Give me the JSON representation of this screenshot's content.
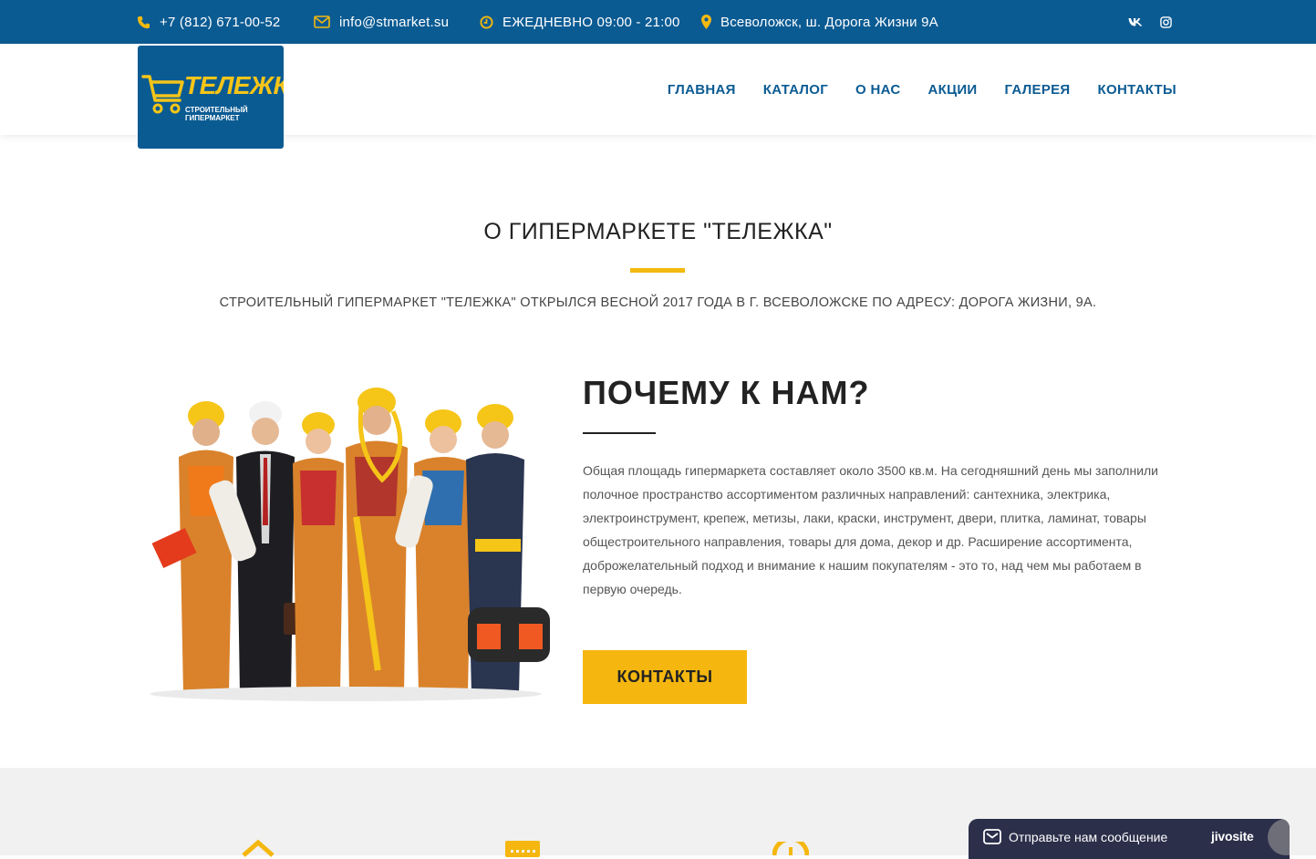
{
  "topbar": {
    "phone": "+7 (812) 671-00-52",
    "email": "info@stmarket.su",
    "hours": "ЕЖЕДНЕВНО 09:00 - 21:00",
    "address": "Всеволожск, ш. Дорога Жизни 9А",
    "social": [
      "vk-icon",
      "instagram-icon"
    ]
  },
  "header": {
    "logo_brand": "ТЕЛЕЖКА",
    "logo_tagline": "СТРОИТЕЛЬНЫЙ ГИПЕРМАРКЕТ",
    "nav": [
      "ГЛАВНАЯ",
      "КАТАЛОГ",
      "О НАС",
      "АКЦИИ",
      "ГАЛЕРЕЯ",
      "КОНТАКТЫ"
    ]
  },
  "about": {
    "title": "О ГИПЕРМАРКЕТЕ \"ТЕЛЕЖКА\"",
    "subtitle": "СТРОИТЕЛЬНЫЙ ГИПЕРМАРКЕТ \"ТЕЛЕЖКА\" ОТКРЫЛСЯ ВЕСНОЙ 2017 ГОДА В Г. ВСЕВОЛОЖСКЕ ПО АДРЕСУ: ДОРОГА ЖИЗНИ, 9А."
  },
  "why": {
    "title": "ПОЧЕМУ К НАМ?",
    "text": "Общая площадь гипермаркета составляет около 3500 кв.м. На сегодняшний день мы заполнили полочное пространство ассортиментом различных направлений: сантехника, электрика, электроинструмент, крепеж, метизы, лаки, краски, инструмент, двери, плитка, ламинат, товары общестроительного направления, товары для дома, декор и др. Расширение ассортимента, доброжелательный подход и внимание к нашим покупателям - это то, над чем мы работаем в первую очередь.",
    "button": "КОНТАКТЫ"
  },
  "chat": {
    "message": "Отправьте нам сообщение",
    "brand": "jivosite"
  },
  "colors": {
    "primary": "#0b5b93",
    "accent": "#f5b70f",
    "chat_bg": "#2b2f4a"
  }
}
